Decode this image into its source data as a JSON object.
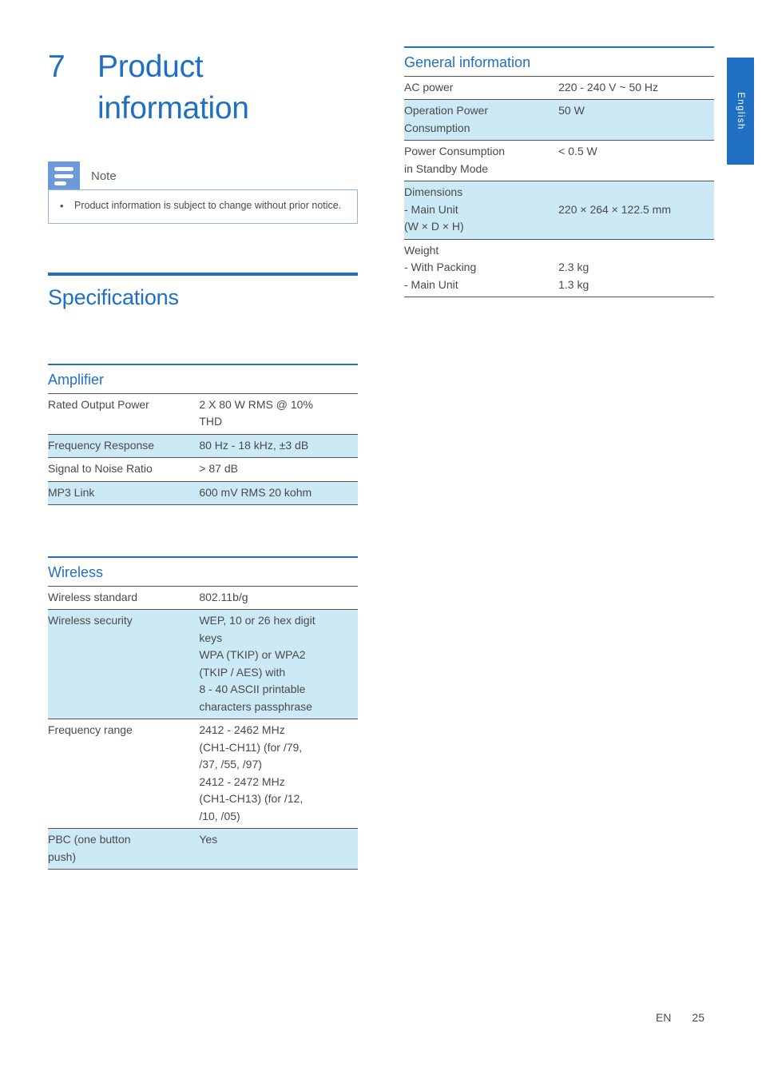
{
  "page": {
    "chapter_number": "7",
    "chapter_title": "Product information",
    "language_tab": "English",
    "footer_locale": "EN",
    "footer_page": "25",
    "accent_color": "#1f6fc4",
    "row_highlight_color": "#cbeaf5",
    "note_icon_color": "#6c9ad8"
  },
  "note": {
    "icon": "note-lines-icon",
    "label": "Note",
    "bullet": "•",
    "items": [
      "Product information is subject to change without prior notice."
    ]
  },
  "specifications": {
    "title": "Specifications",
    "sections": [
      {
        "heading": "Amplifier",
        "rows": [
          {
            "key": "Rated Output Power",
            "value": "2 X 80 W RMS @ 10%\nTHD",
            "highlight": false
          },
          {
            "key": "Frequency Response",
            "value": "80 Hz - 18 kHz, ±3 dB",
            "highlight": true
          },
          {
            "key": "Signal to Noise Ratio",
            "value": "> 87 dB",
            "highlight": false
          },
          {
            "key": "MP3 Link",
            "value": "600 mV RMS 20 kohm",
            "highlight": true
          }
        ]
      },
      {
        "heading": "Wireless",
        "rows": [
          {
            "key": "Wireless standard",
            "value": "802.11b/g",
            "highlight": false
          },
          {
            "key": "Wireless security",
            "value": "WEP, 10 or 26 hex digit\nkeys\nWPA (TKIP) or WPA2\n(TKIP / AES) with\n8 - 40 ASCII printable\ncharacters passphrase",
            "highlight": true
          },
          {
            "key": "Frequency range",
            "value": "2412 - 2462 MHz\n(CH1-CH11) (for /79,\n/37, /55, /97)\n2412 - 2472 MHz\n(CH1-CH13) (for /12,\n/10, /05)",
            "highlight": false
          },
          {
            "key": "PBC (one button\npush)",
            "value": "Yes",
            "highlight": true
          }
        ]
      }
    ]
  },
  "general_information": {
    "heading": "General information",
    "rows": [
      {
        "key": "AC power",
        "value": "220 - 240 V ~ 50 Hz",
        "highlight": false
      },
      {
        "key": "Operation Power\nConsumption",
        "value": "50 W",
        "highlight": true
      },
      {
        "key": "Power Consumption\nin Standby Mode",
        "value": "< 0.5 W",
        "highlight": false
      },
      {
        "key": "Dimensions\n- Main Unit\n  (W × D × H)",
        "value": "\n220 × 264 × 122.5 mm",
        "highlight": true
      },
      {
        "key": "Weight\n- With Packing\n- Main Unit",
        "value": "\n2.3 kg\n1.3 kg",
        "highlight": false
      }
    ]
  }
}
